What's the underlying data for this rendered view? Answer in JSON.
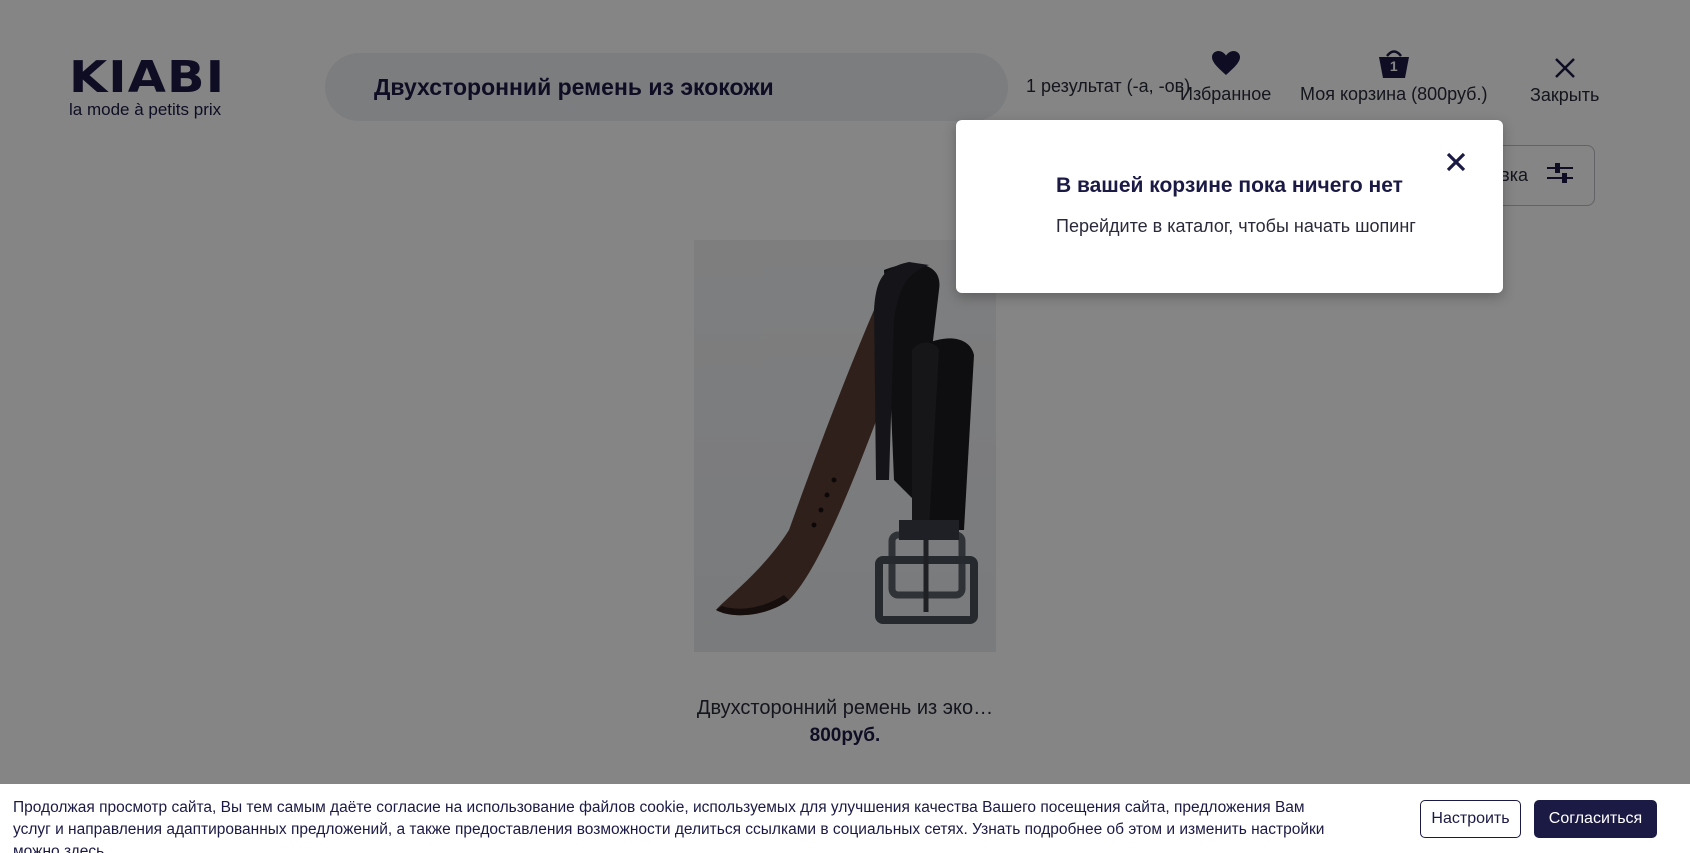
{
  "header": {
    "logo_text": "KIABI",
    "logo_tagline": "la mode à petits prix",
    "search_value": "Двухсторонний ремень из экокожи",
    "results_text": "1 результат (-а, -ов)",
    "favorites_label": "Избранное",
    "cart_label": "Моя корзина (800руб.)",
    "cart_count": "1",
    "close_label": "Закрыть",
    "filter_label_partial": "вка"
  },
  "product": {
    "name": "Двухсторонний ремень из эко…",
    "price": "800руб."
  },
  "popup": {
    "title": "В вашей корзине пока ничего нет",
    "text": "Перейдите в каталог, чтобы начать шопинг"
  },
  "cookie": {
    "text": "Продолжая просмотр сайта, Вы тем самым даёте согласие на использование файлов cookie, используемых для улучшения качества Вашего посещения сайта, предложения Вам услуг и направления адаптированных предложений, а также предоставления возможности делиться ссылками в социальных сетях. Узнать подробнее об этом и изменить настройки можно",
    "link_text": "здесь",
    "configure_label": "Настроить",
    "accept_label": "Согласиться"
  },
  "colors": {
    "brand_navy": "#1b1a45",
    "overlay": "rgba(0,0,0,0.48)"
  },
  "icons": [
    "heart-icon",
    "basket-icon",
    "close-icon",
    "filter-sliders-icon",
    "popup-close-icon"
  ]
}
